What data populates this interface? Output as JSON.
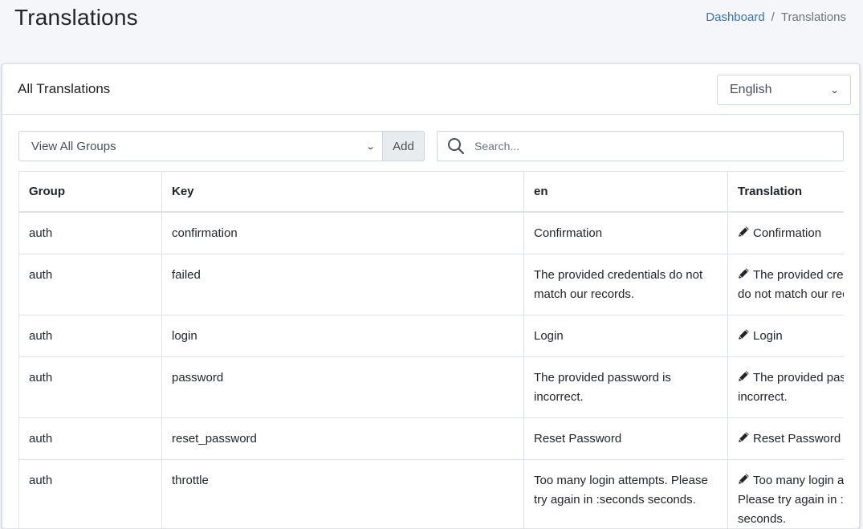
{
  "page": {
    "title": "Translations"
  },
  "breadcrumb": {
    "home": "Dashboard",
    "separator": "/",
    "current": "Translations"
  },
  "card": {
    "title": "All Translations",
    "language_select": "English"
  },
  "toolbar": {
    "group_select": "View All Groups",
    "add_label": "Add",
    "search_placeholder": "Search..."
  },
  "table": {
    "headers": [
      "Group",
      "Key",
      "en",
      "Translation"
    ],
    "rows": [
      {
        "group": "auth",
        "key": "confirmation",
        "en": "Confirmation",
        "translation": "Confirmation"
      },
      {
        "group": "auth",
        "key": "failed",
        "en": "The provided credentials do not match our records.",
        "translation": "The provided credentials do not match our records."
      },
      {
        "group": "auth",
        "key": "login",
        "en": "Login",
        "translation": "Login"
      },
      {
        "group": "auth",
        "key": "password",
        "en": "The provided password is incorrect.",
        "translation": "The provided password is incorrect."
      },
      {
        "group": "auth",
        "key": "reset_password",
        "en": "Reset Password",
        "translation": "Reset Password"
      },
      {
        "group": "auth",
        "key": "throttle",
        "en": "Too many login attempts. Please try again in :seconds seconds.",
        "translation": "Too many login attempts. Please try again in :seconds seconds."
      }
    ]
  },
  "icons": {
    "search": "search-icon",
    "edit": "pencil-icon",
    "dropdown": "chevron-down-icon"
  },
  "colors": {
    "link": "#3172c8",
    "background": "#f4f6f9",
    "border": "#dee2e6"
  }
}
